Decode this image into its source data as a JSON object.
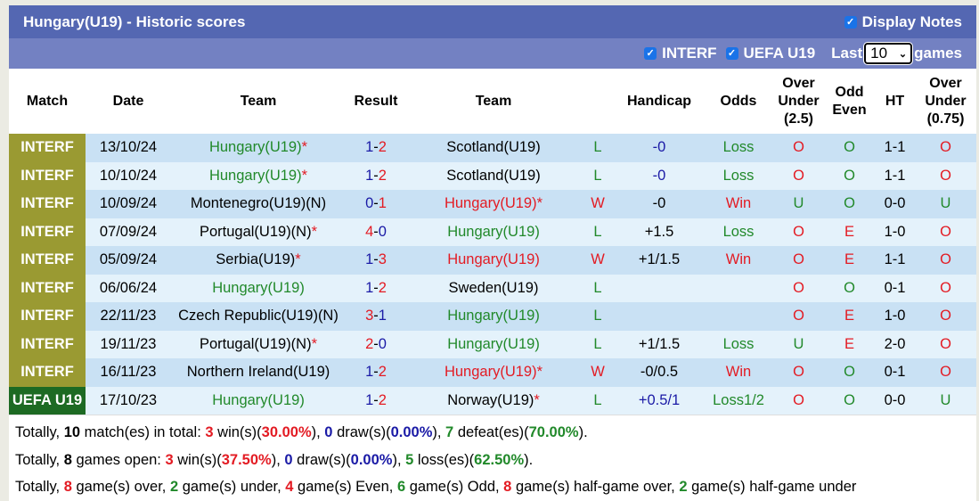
{
  "header": {
    "title": "Hungary(U19) - Historic scores",
    "display_notes_label": "Display Notes",
    "display_notes_checked": true
  },
  "filters": {
    "interf_label": "INTERF",
    "interf_checked": true,
    "uefa_label": "UEFA U19",
    "uefa_checked": true,
    "last_label": "Last",
    "last_value": "10",
    "games_label": "games"
  },
  "columns": {
    "match": "Match",
    "date": "Date",
    "team_home": "Team",
    "result": "Result",
    "team_away": "Team",
    "handicap": "Handicap",
    "odds": "Odds",
    "ou_line1": "Over",
    "ou_line2": "Under",
    "ou_line3": "(2.5)",
    "oe_line1": "Odd",
    "oe_line2": "Even",
    "ht": "HT",
    "ou2_line1": "Over",
    "ou2_line2": "Under",
    "ou2_line3": "(0.75)"
  },
  "colors": {
    "interf_bg": "#9a9a32",
    "uefa_bg": "#1d6a23",
    "win_red": "#e31b23",
    "loss_green": "#21892a",
    "score_blue": "#1a1aa6",
    "header_blue": "#5467b2",
    "filter_blue": "#7381c2"
  },
  "rows": [
    {
      "league": "INTERF",
      "league_type": "interf",
      "date": "13/10/24",
      "home": "Hungary(U19)",
      "home_star": "*",
      "home_color": "g",
      "score_h": "1",
      "score_h_color": "b",
      "score_a": "2",
      "score_a_color": "r",
      "away": "Scotland(U19)",
      "away_star": "",
      "away_color": "k",
      "wl": "L",
      "wl_color": "g",
      "handicap": "-0",
      "handicap_color": "b",
      "odds": "Loss",
      "odds_color": "g",
      "ou": "O",
      "ou_color": "r",
      "oe": "O",
      "oe_color": "g",
      "ht": "1-1",
      "ou2": "O",
      "ou2_color": "r"
    },
    {
      "league": "INTERF",
      "league_type": "interf",
      "date": "10/10/24",
      "home": "Hungary(U19)",
      "home_star": "*",
      "home_color": "g",
      "score_h": "1",
      "score_h_color": "b",
      "score_a": "2",
      "score_a_color": "r",
      "away": "Scotland(U19)",
      "away_star": "",
      "away_color": "k",
      "wl": "L",
      "wl_color": "g",
      "handicap": "-0",
      "handicap_color": "b",
      "odds": "Loss",
      "odds_color": "g",
      "ou": "O",
      "ou_color": "r",
      "oe": "O",
      "oe_color": "g",
      "ht": "1-1",
      "ou2": "O",
      "ou2_color": "r"
    },
    {
      "league": "INTERF",
      "league_type": "interf",
      "date": "10/09/24",
      "home": "Montenegro(U19)(N)",
      "home_star": "",
      "home_color": "k",
      "score_h": "0",
      "score_h_color": "b",
      "score_a": "1",
      "score_a_color": "r",
      "away": "Hungary(U19)",
      "away_star": "*",
      "away_color": "r",
      "wl": "W",
      "wl_color": "r",
      "handicap": "-0",
      "handicap_color": "k",
      "odds": "Win",
      "odds_color": "r",
      "ou": "U",
      "ou_color": "g",
      "oe": "O",
      "oe_color": "g",
      "ht": "0-0",
      "ou2": "U",
      "ou2_color": "g"
    },
    {
      "league": "INTERF",
      "league_type": "interf",
      "date": "07/09/24",
      "home": "Portugal(U19)(N)",
      "home_star": "*",
      "home_color": "k",
      "score_h": "4",
      "score_h_color": "r",
      "score_a": "0",
      "score_a_color": "b",
      "away": "Hungary(U19)",
      "away_star": "",
      "away_color": "g",
      "wl": "L",
      "wl_color": "g",
      "handicap": "+1.5",
      "handicap_color": "k",
      "odds": "Loss",
      "odds_color": "g",
      "ou": "O",
      "ou_color": "r",
      "oe": "E",
      "oe_color": "r",
      "ht": "1-0",
      "ou2": "O",
      "ou2_color": "r"
    },
    {
      "league": "INTERF",
      "league_type": "interf",
      "date": "05/09/24",
      "home": "Serbia(U19)",
      "home_star": "*",
      "home_color": "k",
      "score_h": "1",
      "score_h_color": "b",
      "score_a": "3",
      "score_a_color": "r",
      "away": "Hungary(U19)",
      "away_star": "",
      "away_color": "r",
      "wl": "W",
      "wl_color": "r",
      "handicap": "+1/1.5",
      "handicap_color": "k",
      "odds": "Win",
      "odds_color": "r",
      "ou": "O",
      "ou_color": "r",
      "oe": "E",
      "oe_color": "r",
      "ht": "1-1",
      "ou2": "O",
      "ou2_color": "r"
    },
    {
      "league": "INTERF",
      "league_type": "interf",
      "date": "06/06/24",
      "home": "Hungary(U19)",
      "home_star": "",
      "home_color": "g",
      "score_h": "1",
      "score_h_color": "b",
      "score_a": "2",
      "score_a_color": "r",
      "away": "Sweden(U19)",
      "away_star": "",
      "away_color": "k",
      "wl": "L",
      "wl_color": "g",
      "handicap": "",
      "handicap_color": "k",
      "odds": "",
      "odds_color": "k",
      "ou": "O",
      "ou_color": "r",
      "oe": "O",
      "oe_color": "g",
      "ht": "0-1",
      "ou2": "O",
      "ou2_color": "r"
    },
    {
      "league": "INTERF",
      "league_type": "interf",
      "date": "22/11/23",
      "home": "Czech Republic(U19)(N)",
      "home_star": "",
      "home_color": "k",
      "score_h": "3",
      "score_h_color": "r",
      "score_a": "1",
      "score_a_color": "b",
      "away": "Hungary(U19)",
      "away_star": "",
      "away_color": "g",
      "wl": "L",
      "wl_color": "g",
      "handicap": "",
      "handicap_color": "k",
      "odds": "",
      "odds_color": "k",
      "ou": "O",
      "ou_color": "r",
      "oe": "E",
      "oe_color": "r",
      "ht": "1-0",
      "ou2": "O",
      "ou2_color": "r"
    },
    {
      "league": "INTERF",
      "league_type": "interf",
      "date": "19/11/23",
      "home": "Portugal(U19)(N)",
      "home_star": "*",
      "home_color": "k",
      "score_h": "2",
      "score_h_color": "r",
      "score_a": "0",
      "score_a_color": "b",
      "away": "Hungary(U19)",
      "away_star": "",
      "away_color": "g",
      "wl": "L",
      "wl_color": "g",
      "handicap": "+1/1.5",
      "handicap_color": "k",
      "odds": "Loss",
      "odds_color": "g",
      "ou": "U",
      "ou_color": "g",
      "oe": "E",
      "oe_color": "r",
      "ht": "2-0",
      "ou2": "O",
      "ou2_color": "r"
    },
    {
      "league": "INTERF",
      "league_type": "interf",
      "date": "16/11/23",
      "home": "Northern Ireland(U19)",
      "home_star": "",
      "home_color": "k",
      "score_h": "1",
      "score_h_color": "b",
      "score_a": "2",
      "score_a_color": "r",
      "away": "Hungary(U19)",
      "away_star": "*",
      "away_color": "r",
      "wl": "W",
      "wl_color": "r",
      "handicap": "-0/0.5",
      "handicap_color": "k",
      "odds": "Win",
      "odds_color": "r",
      "ou": "O",
      "ou_color": "r",
      "oe": "O",
      "oe_color": "g",
      "ht": "0-1",
      "ou2": "O",
      "ou2_color": "r"
    },
    {
      "league": "UEFA U19",
      "league_type": "uefa",
      "date": "17/10/23",
      "home": "Hungary(U19)",
      "home_star": "",
      "home_color": "g",
      "score_h": "1",
      "score_h_color": "b",
      "score_a": "2",
      "score_a_color": "r",
      "away": "Norway(U19)",
      "away_star": "*",
      "away_color": "k",
      "wl": "L",
      "wl_color": "g",
      "handicap": "+0.5/1",
      "handicap_color": "b",
      "odds": "Loss1/2",
      "odds_color": "g",
      "ou": "O",
      "ou_color": "r",
      "oe": "O",
      "oe_color": "g",
      "ht": "0-0",
      "ou2": "U",
      "ou2_color": "g"
    }
  ],
  "summary": {
    "line1": {
      "prefix": "Totally, ",
      "matches": "10",
      "t1": " match(es) in total: ",
      "wins": "3",
      "t2": " win(s)(",
      "win_pct": "30.00%",
      "t3": "), ",
      "draws": "0",
      "t4": " draw(s)(",
      "draw_pct": "0.00%",
      "t5": "), ",
      "defeats": "7",
      "t6": " defeat(es)(",
      "defeat_pct": "70.00%",
      "t7": ")."
    },
    "line2": {
      "prefix": "Totally, ",
      "games": "8",
      "t1": " games open: ",
      "wins": "3",
      "t2": " win(s)(",
      "win_pct": "37.50%",
      "t3": "), ",
      "draws": "0",
      "t4": " draw(s)(",
      "draw_pct": "0.00%",
      "t5": "), ",
      "losses": "5",
      "t6": " loss(es)(",
      "loss_pct": "62.50%",
      "t7": ")."
    },
    "line3": {
      "prefix": "Totally, ",
      "over": "8",
      "t1": " game(s) over, ",
      "under": "2",
      "t2": " game(s) under, ",
      "even": "4",
      "t3": " game(s) Even, ",
      "odd": "6",
      "t4": " game(s) Odd, ",
      "hg_over": "8",
      "t5": " game(s) half-game over, ",
      "hg_under": "2",
      "t6": " game(s) half-game under"
    }
  }
}
